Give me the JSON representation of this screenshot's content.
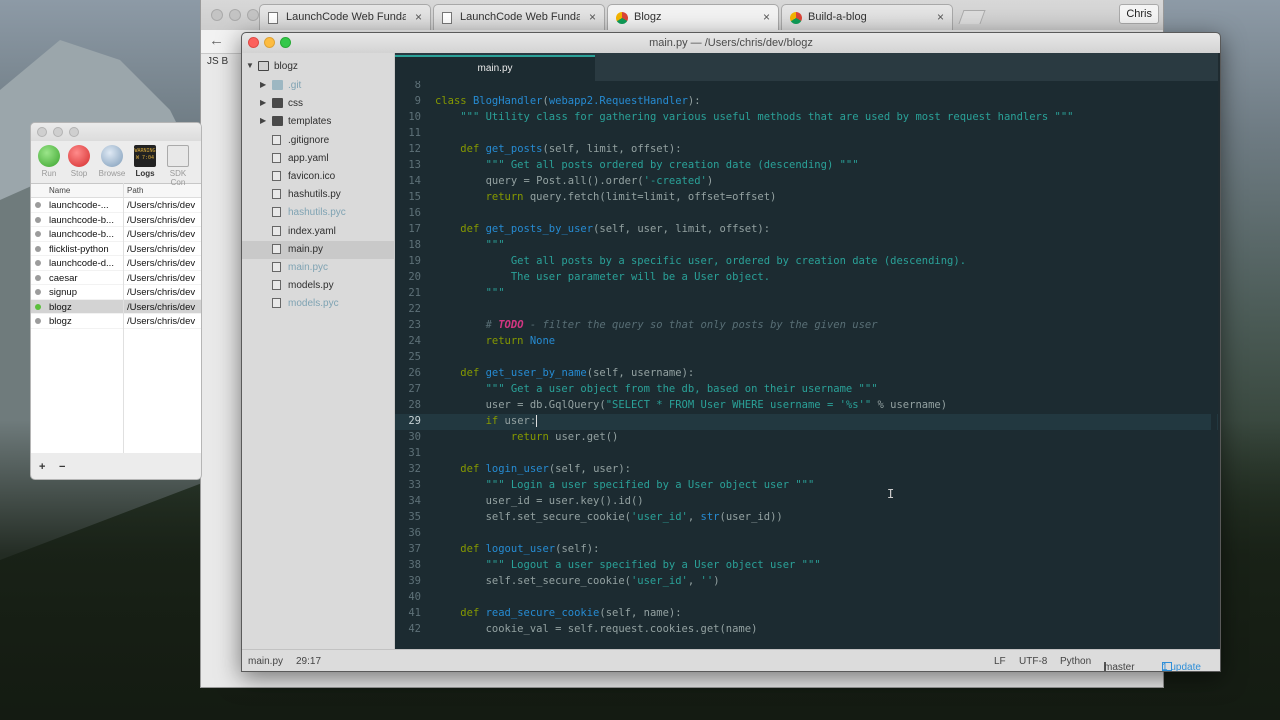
{
  "colors": {
    "editor_bg": "#1c2b31",
    "keyword": "#859900",
    "function": "#268bd2",
    "string": "#2aa198",
    "comment": "#586e75",
    "todo": "#d33682",
    "update_link": "#2f8fd8"
  },
  "browser": {
    "tabs": [
      {
        "label": "LaunchCode Web Fundamenta",
        "icon": "document-icon"
      },
      {
        "label": "LaunchCode Web Fundamenta",
        "icon": "document-icon"
      },
      {
        "label": "Blogz",
        "icon": "chrome-icon"
      },
      {
        "label": "Build-a-blog",
        "icon": "chrome-icon"
      }
    ],
    "profile": "Chris",
    "bookmark": "JS B"
  },
  "launcher": {
    "tools": [
      "Run",
      "Stop",
      "Browse",
      "Logs",
      "SDK Con"
    ],
    "log_badge": "WARNING W 7:04",
    "columns": {
      "name": "Name",
      "path": "Path"
    },
    "rows": [
      {
        "name": "launchcode-...",
        "path": "/Users/chris/dev",
        "running": false,
        "selected": false
      },
      {
        "name": "launchcode-b...",
        "path": "/Users/chris/dev",
        "running": false,
        "selected": false
      },
      {
        "name": "launchcode-b...",
        "path": "/Users/chris/dev",
        "running": false,
        "selected": false
      },
      {
        "name": "flicklist-python",
        "path": "/Users/chris/dev",
        "running": false,
        "selected": false
      },
      {
        "name": "launchcode-d...",
        "path": "/Users/chris/dev",
        "running": false,
        "selected": false
      },
      {
        "name": "caesar",
        "path": "/Users/chris/dev",
        "running": false,
        "selected": false
      },
      {
        "name": "signup",
        "path": "/Users/chris/dev",
        "running": false,
        "selected": false
      },
      {
        "name": "blogz",
        "path": "/Users/chris/dev",
        "running": true,
        "selected": true
      },
      {
        "name": "blogz",
        "path": "/Users/chris/dev",
        "running": false,
        "selected": false
      }
    ],
    "add_label": "+",
    "remove_label": "−"
  },
  "editor": {
    "window_title": "main.py — /Users/chris/dev/blogz",
    "project": "blogz",
    "tree": [
      {
        "name": ".git",
        "kind": "folder-git",
        "depth": 1,
        "dim": true
      },
      {
        "name": "css",
        "kind": "folder",
        "depth": 1,
        "dim": false
      },
      {
        "name": "templates",
        "kind": "folder",
        "depth": 1,
        "dim": false
      },
      {
        "name": ".gitignore",
        "kind": "file",
        "depth": 1,
        "dim": false
      },
      {
        "name": "app.yaml",
        "kind": "file",
        "depth": 1,
        "dim": false
      },
      {
        "name": "favicon.ico",
        "kind": "file",
        "depth": 1,
        "dim": false
      },
      {
        "name": "hashutils.py",
        "kind": "file",
        "depth": 1,
        "dim": false
      },
      {
        "name": "hashutils.pyc",
        "kind": "file",
        "depth": 1,
        "dim": true
      },
      {
        "name": "index.yaml",
        "kind": "file",
        "depth": 1,
        "dim": false
      },
      {
        "name": "main.py",
        "kind": "file",
        "depth": 1,
        "dim": false,
        "selected": true
      },
      {
        "name": "main.pyc",
        "kind": "file",
        "depth": 1,
        "dim": true
      },
      {
        "name": "models.py",
        "kind": "file",
        "depth": 1,
        "dim": false
      },
      {
        "name": "models.pyc",
        "kind": "file",
        "depth": 1,
        "dim": true
      }
    ],
    "active_tab": "main.py",
    "current_line": 29,
    "lines": [
      {
        "n": "8",
        "html": ""
      },
      {
        "n": "9",
        "html": "<span class=\"kw\">class</span> <span class=\"fn\">BlogHandler</span>(<span class=\"fn\">webapp2.RequestHandler</span>):"
      },
      {
        "n": "10",
        "html": "    <span class=\"st\">\"\"\" Utility class for gathering various useful methods that are used by most request handlers \"\"\"</span>"
      },
      {
        "n": "11",
        "html": ""
      },
      {
        "n": "12",
        "html": "    <span class=\"kw\">def</span> <span class=\"fn\">get_posts</span>(self, limit, offset):"
      },
      {
        "n": "13",
        "html": "        <span class=\"st\">\"\"\" Get all posts ordered by creation date (descending) \"\"\"</span>"
      },
      {
        "n": "14",
        "html": "        query = Post.all().order(<span class=\"st\">'-created'</span>)"
      },
      {
        "n": "15",
        "html": "        <span class=\"kw\">return</span> query.fetch(limit=limit, offset=offset)"
      },
      {
        "n": "16",
        "html": ""
      },
      {
        "n": "17",
        "html": "    <span class=\"kw\">def</span> <span class=\"fn\">get_posts_by_user</span>(self, user, limit, offset):"
      },
      {
        "n": "18",
        "html": "        <span class=\"st\">\"\"\"</span>"
      },
      {
        "n": "19",
        "html": "            <span class=\"st\">Get all posts by a specific user, ordered by creation date (descending).</span>"
      },
      {
        "n": "20",
        "html": "            <span class=\"st\">The user parameter will be a User object.</span>"
      },
      {
        "n": "21",
        "html": "        <span class=\"st\">\"\"\"</span>"
      },
      {
        "n": "22",
        "html": ""
      },
      {
        "n": "23",
        "html": "        <span class=\"cm\"># <span class=\"todo\">TODO</span> - filter the query so that only posts by the given user</span>"
      },
      {
        "n": "24",
        "html": "        <span class=\"kw\">return</span> <span class=\"bi\">None</span>"
      },
      {
        "n": "25",
        "html": ""
      },
      {
        "n": "26",
        "html": "    <span class=\"kw\">def</span> <span class=\"fn\">get_user_by_name</span>(self, username):"
      },
      {
        "n": "27",
        "html": "        <span class=\"st\">\"\"\" Get a user object from the db, based on their username \"\"\"</span>"
      },
      {
        "n": "28",
        "html": "        user = db.GqlQuery(<span class=\"st\">\"SELECT * FROM User WHERE username = '%s'\"</span> % username)"
      },
      {
        "n": "29",
        "html": "        <span class=\"kw\">if</span> user:<span class=\"cursor\"></span>"
      },
      {
        "n": "30",
        "html": "            <span class=\"kw\">return</span> user.get()"
      },
      {
        "n": "31",
        "html": ""
      },
      {
        "n": "32",
        "html": "    <span class=\"kw\">def</span> <span class=\"fn\">login_user</span>(self, user):"
      },
      {
        "n": "33",
        "html": "        <span class=\"st\">\"\"\" Login a user specified by a User object user \"\"\"</span>"
      },
      {
        "n": "34",
        "html": "        user_id = user.key().id()"
      },
      {
        "n": "35",
        "html": "        self.set_secure_cookie(<span class=\"st\">'user_id'</span>, <span class=\"bi\">str</span>(user_id))"
      },
      {
        "n": "36",
        "html": ""
      },
      {
        "n": "37",
        "html": "    <span class=\"kw\">def</span> <span class=\"fn\">logout_user</span>(self):"
      },
      {
        "n": "38",
        "html": "        <span class=\"st\">\"\"\" Logout a user specified by a User object user \"\"\"</span>"
      },
      {
        "n": "39",
        "html": "        self.set_secure_cookie(<span class=\"st\">'user_id'</span>, <span class=\"st\">''</span>)"
      },
      {
        "n": "40",
        "html": ""
      },
      {
        "n": "41",
        "html": "    <span class=\"kw\">def</span> <span class=\"fn\">read_secure_cookie</span>(self, name):"
      },
      {
        "n": "42",
        "html": "        cookie_val = self.request.cookies.get(name)"
      }
    ],
    "status": {
      "file": "main.py",
      "position": "29:17",
      "line_ending": "LF",
      "encoding": "UTF-8",
      "grammar": "Python",
      "branch": "master",
      "updates": "1 update"
    }
  }
}
